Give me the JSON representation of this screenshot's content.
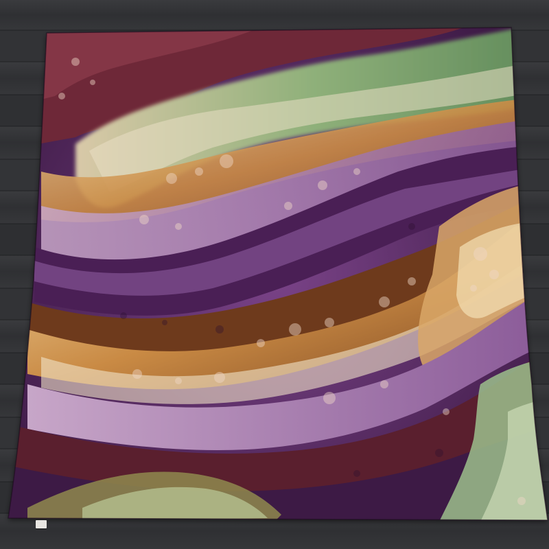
{
  "scene": {
    "floor_color": "#2e2f32",
    "palette": {
      "purple_deep": "#3d1a45",
      "purple": "#6b3a7a",
      "lavender": "#b08bb5",
      "maroon": "#5a1f2e",
      "brown": "#6e3a1c",
      "amber": "#c98a44",
      "gold": "#e8c38a",
      "cream": "#f0e2c8",
      "sage": "#9cbf8c",
      "olive": "#6f7a3e"
    }
  }
}
